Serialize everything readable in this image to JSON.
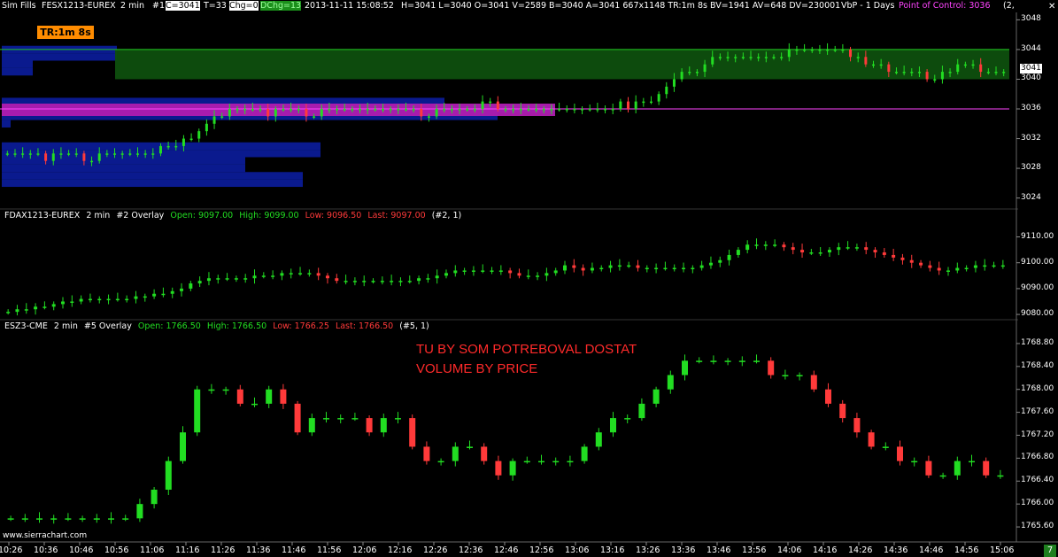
{
  "colors": {
    "up": "#22dd22",
    "down": "#ff3a3a",
    "poc": "#ff44ff",
    "value_area": "#0e4f0e",
    "profile": "#0a1a8e",
    "orange": "#ff8c00",
    "annotation": "#ff2a2a"
  },
  "toolbar": {
    "sim": "Sim Fills",
    "symbol": "FESX1213-EUREX",
    "interval": "2 min",
    "chart_no": "#1",
    "c": "C=3041",
    "t": "T=33",
    "chg": "Chg=0",
    "dchg": "DChg=13",
    "datetime": "2013-11-11  15:08:52",
    "stats": "H=3041  L=3040  O=3041  V=2589  B=3040  A=3041  667x1148  TR:1m 8s  BV=1941  AV=648  DV=230001",
    "vbp": "VbP - 1 Days",
    "poc": "Point of Control: 3036",
    "tail": "(2,"
  },
  "tr_badge": "TR:1m 8s",
  "close_icon": "x-icon",
  "pane2": {
    "symbol": "FDAX1213-EUREX",
    "interval": "2 min",
    "overlay": "#2 Overlay",
    "open": "Open: 9097.00",
    "high": "High: 9099.00",
    "low": "Low: 9096.50",
    "last": "Last: 9097.00",
    "ref": "(#2, 1)"
  },
  "pane3": {
    "symbol": "ESZ3-CME",
    "interval": "2 min",
    "overlay": "#5 Overlay",
    "open": "Open: 1766.50",
    "high": "High: 1766.50",
    "low": "Low: 1766.25",
    "last": "Last: 1766.50",
    "ref": "(#5, 1)"
  },
  "annotation": {
    "line1": "TU BY SOM POTREBOVAL DOSTAT",
    "line2": "VOLUME BY PRICE"
  },
  "watermark": "www.sierrachart.com",
  "last_price": "3041",
  "bottom_num": "7",
  "y_axis": {
    "pane1": [
      "3048",
      "3044",
      "3040",
      "3036",
      "3032",
      "3028",
      "3024"
    ],
    "pane2": [
      "9110.00",
      "9100.00",
      "9090.00",
      "9080.00"
    ],
    "pane3": [
      "1768.80",
      "1768.40",
      "1768.00",
      "1767.60",
      "1767.20",
      "1766.80",
      "1766.40",
      "1766.00",
      "1765.60"
    ]
  },
  "x_axis": [
    "10:26",
    "10:36",
    "10:46",
    "10:56",
    "11:06",
    "11:16",
    "11:26",
    "11:36",
    "11:46",
    "11:56",
    "12:06",
    "12:16",
    "12:26",
    "12:36",
    "12:46",
    "12:56",
    "13:06",
    "13:16",
    "13:26",
    "13:36",
    "13:46",
    "13:56",
    "14:06",
    "14:16",
    "14:26",
    "14:36",
    "14:46",
    "14:56",
    "15:06"
  ],
  "chart_data": [
    {
      "type": "candlestick",
      "symbol": "FESX1213-EUREX",
      "ylim": [
        3023,
        3049
      ],
      "point_of_control": 3036,
      "value_area": [
        3040,
        3044
      ],
      "close": [
        3030,
        3030,
        3030,
        3030,
        3030,
        3029,
        3030,
        3030,
        3030,
        3030,
        3029,
        3029,
        3030,
        3030,
        3030,
        3030,
        3030,
        3030,
        3030,
        3030,
        3031,
        3031,
        3031,
        3032,
        3032,
        3033,
        3034,
        3035,
        3035,
        3036,
        3036,
        3036,
        3036,
        3036,
        3035,
        3036,
        3036,
        3036,
        3036,
        3035,
        3035,
        3036,
        3036,
        3036,
        3036,
        3036,
        3036,
        3036,
        3036,
        3036,
        3036,
        3036,
        3036,
        3036,
        3035,
        3035,
        3036,
        3036,
        3036,
        3036,
        3036,
        3036,
        3037,
        3037,
        3036,
        3036,
        3036,
        3036,
        3036,
        3036,
        3036,
        3036,
        3036,
        3036,
        3036,
        3036,
        3036,
        3036,
        3036,
        3036,
        3037,
        3036,
        3037,
        3037,
        3037,
        3038,
        3039,
        3040,
        3041,
        3041,
        3041,
        3042,
        3043,
        3043,
        3043,
        3043,
        3043,
        3043,
        3043,
        3043,
        3043,
        3043,
        3044,
        3044,
        3044,
        3044,
        3044,
        3044,
        3044,
        3044,
        3043,
        3043,
        3042,
        3042,
        3042,
        3041,
        3041,
        3041,
        3041,
        3041,
        3040,
        3040,
        3041,
        3041,
        3042,
        3042,
        3042,
        3041,
        3041,
        3041,
        3041
      ]
    },
    {
      "type": "candlestick",
      "symbol": "FDAX1213-EUREX",
      "ylim": [
        9079,
        9116
      ],
      "open": 9097.0,
      "high": 9099.0,
      "low": 9096.5,
      "last": 9097.0,
      "close": [
        9081,
        9082,
        9082,
        9083,
        9083,
        9084,
        9085,
        9085,
        9086,
        9086,
        9086,
        9086,
        9086,
        9086,
        9087,
        9087,
        9088,
        9088,
        9089,
        9090,
        9092,
        9093,
        9094,
        9094,
        9094,
        9094,
        9094,
        9095,
        9095,
        9095,
        9096,
        9096,
        9096,
        9096,
        9095,
        9094,
        9093,
        9093,
        9093,
        9093,
        9093,
        9093,
        9093,
        9093,
        9093,
        9094,
        9094,
        9095,
        9096,
        9097,
        9097,
        9097,
        9097,
        9097,
        9097,
        9096,
        9095,
        9095,
        9095,
        9096,
        9097,
        9099,
        9098,
        9097,
        9098,
        9098,
        9099,
        9099,
        9099,
        9098,
        9098,
        9098,
        9098,
        9098,
        9098,
        9098,
        9099,
        9100,
        9101,
        9103,
        9105,
        9107,
        9107,
        9107,
        9107,
        9106,
        9105,
        9104,
        9104,
        9104,
        9105,
        9106,
        9106,
        9106,
        9105,
        9104,
        9103,
        9102,
        9101,
        9100,
        9099,
        9098,
        9097,
        9097,
        9098,
        9098,
        9099,
        9099,
        9099,
        9099
      ]
    },
    {
      "type": "candlestick",
      "symbol": "ESZ3-CME",
      "ylim": [
        1765.4,
        1769.0
      ],
      "open": 1766.5,
      "high": 1766.5,
      "low": 1766.25,
      "last": 1766.5,
      "close": [
        1765.75,
        1765.75,
        1765.75,
        1765.75,
        1765.75,
        1765.75,
        1765.75,
        1765.75,
        1765.75,
        1766.0,
        1766.25,
        1766.75,
        1767.25,
        1768.0,
        1768.0,
        1768.0,
        1767.75,
        1767.75,
        1768.0,
        1767.75,
        1767.25,
        1767.5,
        1767.5,
        1767.5,
        1767.5,
        1767.25,
        1767.5,
        1767.5,
        1767.0,
        1766.75,
        1766.75,
        1767.0,
        1767.0,
        1766.75,
        1766.5,
        1766.75,
        1766.75,
        1766.75,
        1766.75,
        1766.75,
        1767.0,
        1767.25,
        1767.5,
        1767.5,
        1767.75,
        1768.0,
        1768.25,
        1768.5,
        1768.5,
        1768.5,
        1768.5,
        1768.5,
        1768.5,
        1768.25,
        1768.25,
        1768.25,
        1768.0,
        1767.75,
        1767.5,
        1767.25,
        1767.0,
        1767.0,
        1766.75,
        1766.75,
        1766.5,
        1766.5,
        1766.75,
        1766.75,
        1766.5,
        1766.5
      ]
    }
  ]
}
